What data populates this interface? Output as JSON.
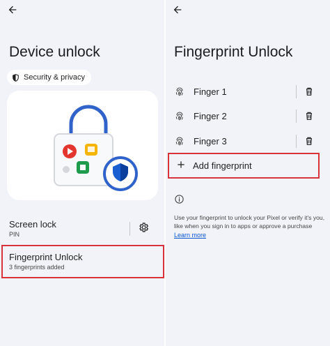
{
  "left": {
    "back_icon": "arrow-back-icon",
    "title": "Device unlock",
    "chip": {
      "icon": "shield-icon",
      "label": "Security & privacy"
    },
    "screen_lock": {
      "title": "Screen lock",
      "subtitle": "PIN",
      "settings_icon": "gear-icon"
    },
    "fingerprint_unlock": {
      "title": "Fingerprint Unlock",
      "subtitle": "3 fingerprints added"
    }
  },
  "right": {
    "back_icon": "arrow-back-icon",
    "title": "Fingerprint Unlock",
    "fingers": [
      {
        "label": "Finger 1",
        "icon": "fingerprint-icon",
        "delete_icon": "trash-icon"
      },
      {
        "label": "Finger 2",
        "icon": "fingerprint-icon",
        "delete_icon": "trash-icon"
      },
      {
        "label": "Finger 3",
        "icon": "fingerprint-icon",
        "delete_icon": "trash-icon"
      }
    ],
    "add_fingerprint": {
      "label": "Add fingerprint",
      "icon": "plus-icon"
    },
    "info": {
      "icon": "info-icon",
      "text": "Use your fingerprint to unlock your Pixel or verify it's you, like when you sign in to apps or approve a purchase",
      "link": "Learn more"
    }
  },
  "colors": {
    "highlight": "#d8323c",
    "link": "#0b57d0",
    "shield_blue": "#1a5fd1",
    "lock_blue": "#2f63c9",
    "background": "#f1f3f8"
  }
}
